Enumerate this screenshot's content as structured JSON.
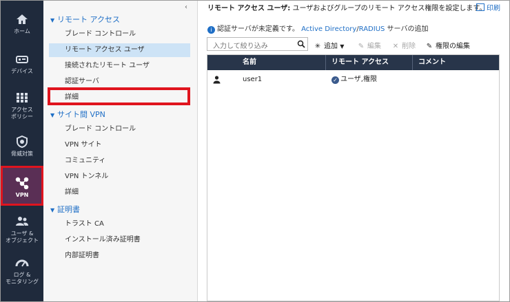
{
  "nav": {
    "items": [
      {
        "label": "ホーム"
      },
      {
        "label": "デバイス"
      },
      {
        "label": "アクセス\nポリシー"
      },
      {
        "label": "脅威対策"
      },
      {
        "label": "VPN"
      },
      {
        "label": "ユーザ &\nオブジェクト"
      },
      {
        "label": "ログ &\nモニタリング"
      }
    ]
  },
  "tree": {
    "collapse_icon": "‹",
    "groups": [
      {
        "label": "リモート アクセス",
        "items": [
          "ブレード コントロール",
          "リモート アクセス ユーザ",
          "接続されたリモート ユーザ",
          "認証サーバ",
          "詳細"
        ]
      },
      {
        "label": "サイト間 VPN",
        "items": [
          "ブレード コントロール",
          "VPN サイト",
          "コミュニティ",
          "VPN トンネル",
          "詳細"
        ]
      },
      {
        "label": "証明書",
        "items": [
          "トラスト CA",
          "インストール済み証明書",
          "内部証明書"
        ]
      }
    ]
  },
  "main": {
    "title_bold": "リモート アクセス ユーザ:",
    "title_rest": " ユーザおよびグループのリモート アクセス権限を設定します。",
    "print_label": "印刷",
    "info_text": "認証サーバが未定義です。",
    "info_link1": "Active Directory",
    "info_sep": "/",
    "info_link2": "RADIUS",
    "info_tail": " サーバの追加",
    "search_placeholder": "入力して絞り込み",
    "toolbar": {
      "add": "追加",
      "edit": "編集",
      "delete": "削除",
      "edit_perm": "権限の編集"
    },
    "table": {
      "columns": [
        "名前",
        "リモート アクセス",
        "コメント"
      ],
      "rows": [
        {
          "name": "user1",
          "remote_access": "ユーザ,権限",
          "comment": ""
        }
      ]
    }
  },
  "colors": {
    "nav_bg": "#1f2a3c",
    "accent": "#1f6fc6",
    "highlight": "#e0141e",
    "selected": "#cde3f6",
    "table_header": "#28354a"
  }
}
